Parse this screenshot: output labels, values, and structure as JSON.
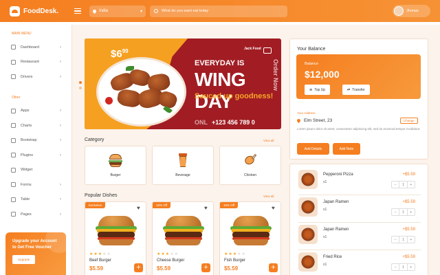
{
  "app": {
    "name": "FoodDesk."
  },
  "header": {
    "location": "India",
    "search_placeholder": "What do you want eat today",
    "user_name": "Jhonas"
  },
  "sidebar": {
    "section_main": "MAIN MENU",
    "main_items": [
      {
        "label": "Dashboard"
      },
      {
        "label": "Restaurant"
      },
      {
        "label": "Drivers"
      }
    ],
    "section_other": "Other",
    "other_items": [
      {
        "label": "Apps"
      },
      {
        "label": "Charts"
      },
      {
        "label": "Bootstrap"
      },
      {
        "label": "Plugins"
      },
      {
        "label": "Widget"
      },
      {
        "label": "Forms"
      },
      {
        "label": "Table"
      },
      {
        "label": "Pages"
      }
    ],
    "upgrade": {
      "text": "Upgrade your Account to Get Free Voucher",
      "button": "Upgrade"
    }
  },
  "banner": {
    "price": "$6",
    "price_cents": "99",
    "brand": "Jack Food",
    "line1": "EVERYDAY IS",
    "line2": "WING DAY",
    "line3": "Sauced up goodness!",
    "online": "ONL",
    "phone": "+123 456 789 0",
    "side_text": "Order Now"
  },
  "category": {
    "title": "Category",
    "view_all": "View all",
    "items": [
      {
        "label": "Burger"
      },
      {
        "label": "Beverage"
      },
      {
        "label": "Chicken"
      }
    ]
  },
  "popular": {
    "title": "Popular Dishes",
    "view_all": "View all",
    "items": [
      {
        "tag": "Exclusive",
        "name": "Beef Burger",
        "price": "$5.59",
        "rating": 3
      },
      {
        "tag": "15% Off",
        "name": "Cheese Burger",
        "price": "$5.59",
        "rating": 3
      },
      {
        "tag": "15% Off",
        "name": "Fish Burger",
        "price": "$5.59",
        "rating": 3
      }
    ]
  },
  "balance": {
    "title": "Your Balance",
    "label": "Balance",
    "amount": "$12,000",
    "topup": "Top Up",
    "transfer": "Transfer",
    "address_label": "Your Address",
    "address": "Elm Street, 23",
    "change": "Change",
    "description": "Lorem ipsum dolor sit amet, consectetur adipiscing elit, sed do eiusmod tempor incididunt.",
    "add_details": "Add Details",
    "add_note": "Add Note"
  },
  "orders": [
    {
      "name": "Pepperoni Pizza",
      "qty_label": "x1",
      "price": "+$5.59",
      "qty": "1"
    },
    {
      "name": "Japan Ramen",
      "qty_label": "x1",
      "price": "+$5.59",
      "qty": "1"
    },
    {
      "name": "Japan Ramen",
      "qty_label": "x1",
      "price": "+$5.59",
      "qty": "1"
    },
    {
      "name": "Fried Rice",
      "qty_label": "x1",
      "price": "+$5.59",
      "qty": "1"
    }
  ],
  "colors": {
    "accent": "#f57e20",
    "banner_red": "#a11d23",
    "banner_yellow": "#f5a020"
  }
}
